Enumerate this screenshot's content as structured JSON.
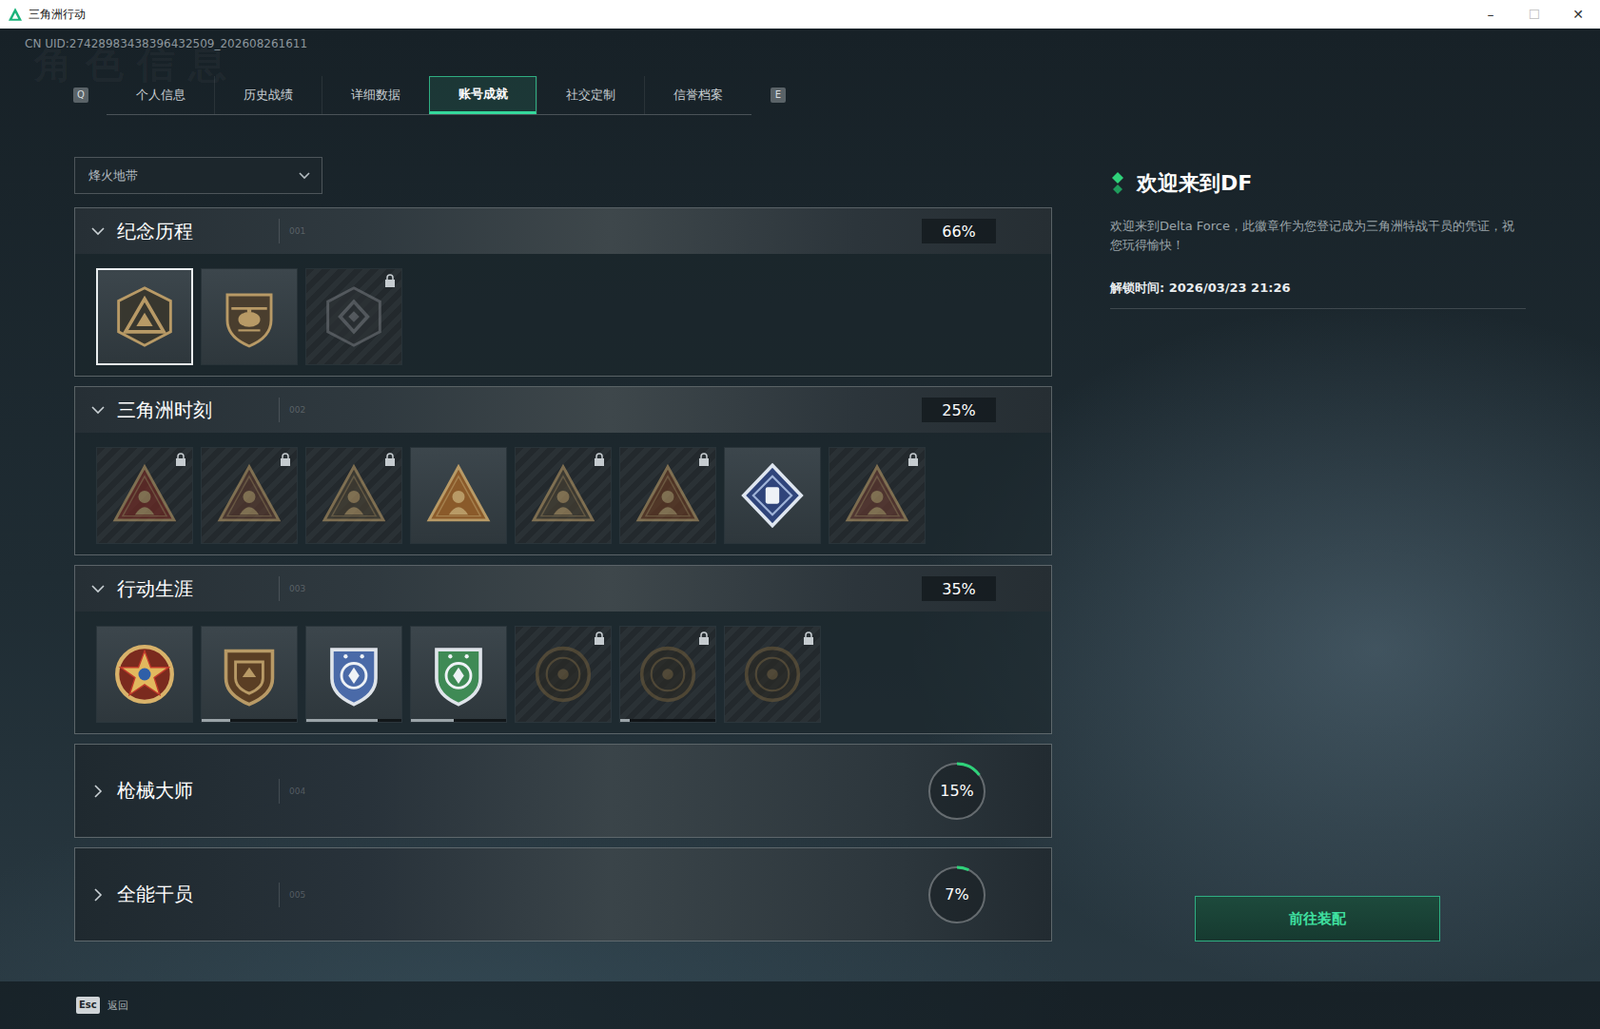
{
  "window": {
    "title": "三角洲行动",
    "controls": [
      {
        "glyph": "–",
        "disabled": false
      },
      {
        "glyph": "☐",
        "disabled": true
      },
      {
        "glyph": "✕",
        "disabled": false
      }
    ]
  },
  "uid": "CN UID:27428983438396432509_202608261611",
  "watermark": "角色信息",
  "tab_keys": {
    "prev": "Q",
    "next": "E"
  },
  "tabs": [
    {
      "label": "个人信息",
      "selected": false
    },
    {
      "label": "历史战绩",
      "selected": false
    },
    {
      "label": "详细数据",
      "selected": false
    },
    {
      "label": "账号成就",
      "selected": true
    },
    {
      "label": "社交定制",
      "selected": false
    },
    {
      "label": "信誉档案",
      "selected": false
    }
  ],
  "mode_select": {
    "value": "烽火地带"
  },
  "sections": [
    {
      "title": "纪念历程",
      "number": "001",
      "percent": "66%",
      "expanded": true,
      "badges": [
        {
          "kind": "emblem",
          "locked": false,
          "selected": true,
          "color": "#b89a66"
        },
        {
          "kind": "heli",
          "locked": false,
          "selected": false,
          "color": "#b89a66"
        },
        {
          "kind": "hexagon",
          "locked": true,
          "selected": false,
          "color": "#70757a"
        }
      ]
    },
    {
      "title": "三角洲时刻",
      "number": "002",
      "percent": "25%",
      "expanded": true,
      "badges": [
        {
          "kind": "triangle",
          "locked": true,
          "selected": false,
          "color": "#7a2a22"
        },
        {
          "kind": "triangle",
          "locked": true,
          "selected": false,
          "color": "#5e3b2e"
        },
        {
          "kind": "triangle",
          "locked": true,
          "selected": false,
          "color": "#4b4232"
        },
        {
          "kind": "triangle",
          "locked": false,
          "selected": false,
          "color": "#8a5a2a"
        },
        {
          "kind": "triangle",
          "locked": true,
          "selected": false,
          "color": "#4b4232"
        },
        {
          "kind": "triangle",
          "locked": true,
          "selected": false,
          "color": "#6c3b20"
        },
        {
          "kind": "diamond",
          "locked": false,
          "selected": false,
          "color": "#2f447a"
        },
        {
          "kind": "triangle",
          "locked": true,
          "selected": false,
          "color": "#6a3a30"
        }
      ]
    },
    {
      "title": "行动生涯",
      "number": "003",
      "percent": "35%",
      "expanded": true,
      "badges": [
        {
          "kind": "star",
          "locked": false,
          "selected": false,
          "color": "#c0392b"
        },
        {
          "kind": "crest",
          "locked": false,
          "selected": false,
          "color": "#b89a66",
          "level": 0.3
        },
        {
          "kind": "shield",
          "locked": false,
          "selected": false,
          "color": "#4a6aa8",
          "level": 0.75
        },
        {
          "kind": "shield",
          "locked": false,
          "selected": false,
          "color": "#3f8a55",
          "level": 0.45
        },
        {
          "kind": "coin",
          "locked": true,
          "selected": false,
          "color": "#6b5a3a"
        },
        {
          "kind": "coin",
          "locked": true,
          "selected": false,
          "color": "#6b5a3a",
          "level": 0.1
        },
        {
          "kind": "coin",
          "locked": true,
          "selected": false,
          "color": "#6b5a3a"
        }
      ]
    },
    {
      "title": "枪械大师",
      "number": "004",
      "percent": "15%",
      "expanded": false,
      "level": 0.15,
      "badges": []
    },
    {
      "title": "全能干员",
      "number": "005",
      "percent": "7%",
      "expanded": false,
      "level": 0.07,
      "badges": []
    }
  ],
  "detail": {
    "title": "欢迎来到DF",
    "description": "欢迎来到Delta Force，此徽章作为您登记成为三角洲特战干员的凭证，祝您玩得愉快！",
    "unlock": "解锁时间: 2026/03/23 21:26",
    "button": "前往装配"
  },
  "footer": {
    "key": "Esc",
    "label": "返回"
  }
}
